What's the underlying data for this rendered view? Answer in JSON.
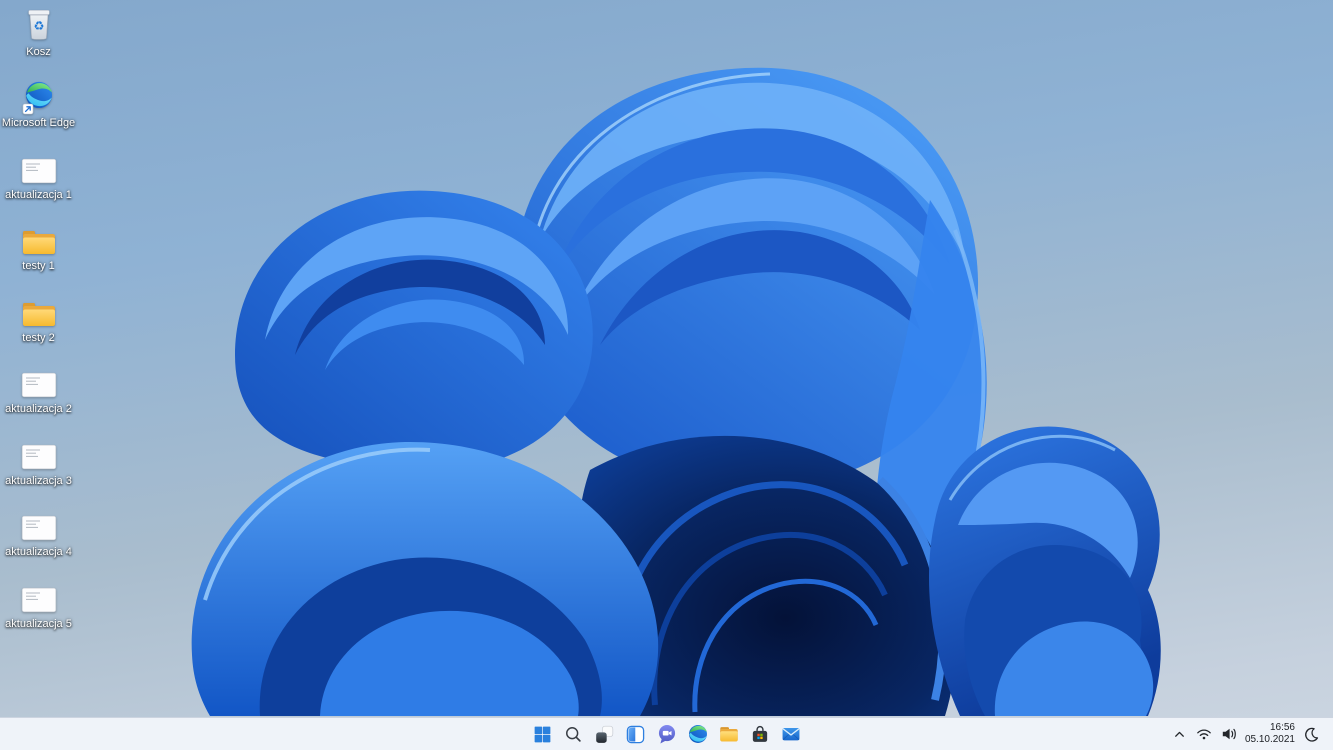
{
  "desktop": {
    "icons": [
      {
        "label": "Kosz",
        "type": "recycle-bin"
      },
      {
        "label": "Microsoft Edge",
        "type": "edge-shortcut"
      },
      {
        "label": "aktualizacja 1",
        "type": "document"
      },
      {
        "label": "testy 1",
        "type": "folder"
      },
      {
        "label": "testy 2",
        "type": "folder"
      },
      {
        "label": "aktualizacja 2",
        "type": "document"
      },
      {
        "label": "aktualizacja 3",
        "type": "document"
      },
      {
        "label": "aktualizacja 4",
        "type": "document"
      },
      {
        "label": "aktualizacja 5",
        "type": "document"
      }
    ]
  },
  "taskbar": {
    "buttons": [
      {
        "name": "Start"
      },
      {
        "name": "Search"
      },
      {
        "name": "Task view"
      },
      {
        "name": "Widgets"
      },
      {
        "name": "Chat"
      },
      {
        "name": "Microsoft Edge"
      },
      {
        "name": "File Explorer"
      },
      {
        "name": "Microsoft Store"
      },
      {
        "name": "Mail"
      }
    ],
    "tray": {
      "time": "16:56",
      "date": "05.10.2021"
    }
  },
  "colors": {
    "taskbar_bg": "#eff3f9",
    "bloom_bright": "#4596f4",
    "bloom_mid": "#2e7ce6",
    "bloom_dark": "#0a2f7d",
    "bloom_deepest": "#041238",
    "desktop_top": "#84a8cc",
    "desktop_bottom": "#ccd6e1"
  }
}
